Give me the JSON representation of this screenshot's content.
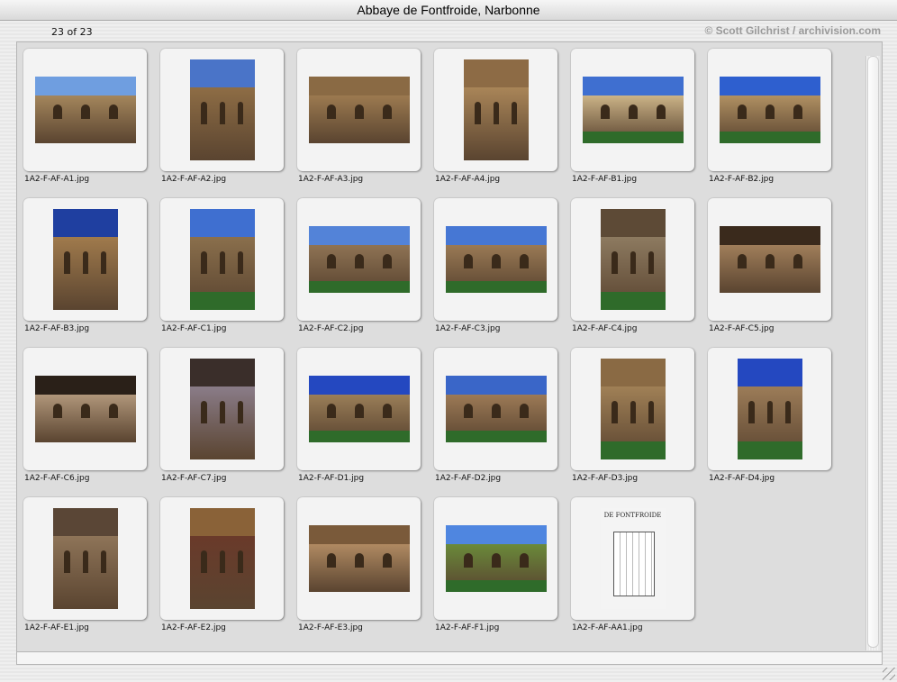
{
  "window": {
    "title": "Abbaye de Fontfroide, Narbonne"
  },
  "toolbar": {
    "counter": "23 of 23",
    "copyright": "© Scott Gilchrist / archivision.com"
  },
  "thumbnails": [
    {
      "file": "1A2-F-AF-A1.jpg",
      "orient": "land",
      "sky": "#6f9ee0",
      "stone": "#a4865c",
      "green": false
    },
    {
      "file": "1A2-F-AF-A2.jpg",
      "orient": "port",
      "sky": "#4a74c8",
      "stone": "#8e6d45",
      "green": false
    },
    {
      "file": "1A2-F-AF-A3.jpg",
      "orient": "land",
      "sky": "#8a6a44",
      "stone": "#9c7a50",
      "green": false
    },
    {
      "file": "1A2-F-AF-A4.jpg",
      "orient": "port",
      "sky": "#8d6b45",
      "stone": "#a98558",
      "green": false
    },
    {
      "file": "1A2-F-AF-B1.jpg",
      "orient": "land",
      "sky": "#3f6fd0",
      "stone": "#cbb387",
      "green": true
    },
    {
      "file": "1A2-F-AF-B2.jpg",
      "orient": "land",
      "sky": "#2e5fcf",
      "stone": "#b09062",
      "green": true
    },
    {
      "file": "1A2-F-AF-B3.jpg",
      "orient": "port",
      "sky": "#1f3fa0",
      "stone": "#a07a4c",
      "green": false
    },
    {
      "file": "1A2-F-AF-C1.jpg",
      "orient": "port",
      "sky": "#3f6fd0",
      "stone": "#8a6f4c",
      "green": true
    },
    {
      "file": "1A2-F-AF-C2.jpg",
      "orient": "land",
      "sky": "#5383d8",
      "stone": "#8f7354",
      "green": true
    },
    {
      "file": "1A2-F-AF-C3.jpg",
      "orient": "land",
      "sky": "#4677d4",
      "stone": "#9a7a55",
      "green": true
    },
    {
      "file": "1A2-F-AF-C4.jpg",
      "orient": "port",
      "sky": "#5d4a36",
      "stone": "#8d7a60",
      "green": true
    },
    {
      "file": "1A2-F-AF-C5.jpg",
      "orient": "land",
      "sky": "#3a2a1c",
      "stone": "#a07e5a",
      "green": false
    },
    {
      "file": "1A2-F-AF-C6.jpg",
      "orient": "land",
      "sky": "#2a2018",
      "stone": "#b0967a",
      "green": false
    },
    {
      "file": "1A2-F-AF-C7.jpg",
      "orient": "port",
      "sky": "#3a2e2a",
      "stone": "#8a7c88",
      "green": false
    },
    {
      "file": "1A2-F-AF-D1.jpg",
      "orient": "land",
      "sky": "#2448c0",
      "stone": "#9a7e58",
      "green": true
    },
    {
      "file": "1A2-F-AF-D2.jpg",
      "orient": "land",
      "sky": "#3a66c8",
      "stone": "#9c7a56",
      "green": true
    },
    {
      "file": "1A2-F-AF-D3.jpg",
      "orient": "port",
      "sky": "#8a6a44",
      "stone": "#a08056",
      "green": true
    },
    {
      "file": "1A2-F-AF-D4.jpg",
      "orient": "port",
      "sky": "#2448c0",
      "stone": "#9c7c58",
      "green": true
    },
    {
      "file": "1A2-F-AF-E1.jpg",
      "orient": "port",
      "sky": "#5a4636",
      "stone": "#8e7458",
      "green": false
    },
    {
      "file": "1A2-F-AF-E2.jpg",
      "orient": "port",
      "sky": "#8a6238",
      "stone": "#6a3a2a",
      "green": false
    },
    {
      "file": "1A2-F-AF-E3.jpg",
      "orient": "land",
      "sky": "#7a5a3a",
      "stone": "#b08a62",
      "green": false
    },
    {
      "file": "1A2-F-AF-F1.jpg",
      "orient": "land",
      "sky": "#4f86e0",
      "stone": "#6a8a3a",
      "green": true
    },
    {
      "file": "1A2-F-AF-AA1.jpg",
      "orient": "port",
      "sky": "#f2f2f2",
      "stone": "#dcdcdc",
      "green": false,
      "plan_text": "DE FONTFROIDE"
    }
  ]
}
